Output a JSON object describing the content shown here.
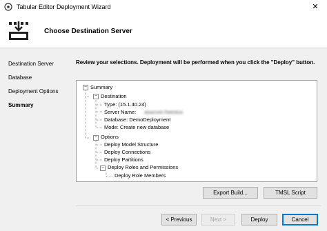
{
  "window": {
    "title": "Tabular Editor Deployment Wizard",
    "close_glyph": "✕"
  },
  "header": {
    "title": "Choose Destination Server",
    "icon": "deploy-icon"
  },
  "sidebar": {
    "items": [
      {
        "label": "Destination Server",
        "active": false
      },
      {
        "label": "Database",
        "active": false
      },
      {
        "label": "Deployment Options",
        "active": false
      },
      {
        "label": "Summary",
        "active": true
      }
    ]
  },
  "main": {
    "instructions": "Review your selections. Deployment will be performed when you click the \"Deploy\" button.",
    "tree": {
      "summary": "Summary",
      "destination": "Destination",
      "type": "Type: (15.1.40.24)",
      "server_name": "Server Name: ",
      "server_value": "asazure://westus",
      "database": "Database: DemoDeployment",
      "mode": "Mode: Create new database",
      "options": "Options",
      "deploy_model_structure": "Deploy Model Structure",
      "deploy_connections": "Deploy Connections",
      "deploy_partitions": "Deploy Partitions",
      "deploy_roles_permissions": "Deploy Roles and Permissions",
      "deploy_role_members": "Deploy Role Members",
      "collapse_glyph": "−"
    },
    "export_build_label": "Export Build...",
    "tmsl_script_label": "TMSL Script"
  },
  "footer": {
    "previous_label": "< Previous",
    "next_label": "Next >",
    "deploy_label": "Deploy",
    "cancel_label": "Cancel"
  }
}
